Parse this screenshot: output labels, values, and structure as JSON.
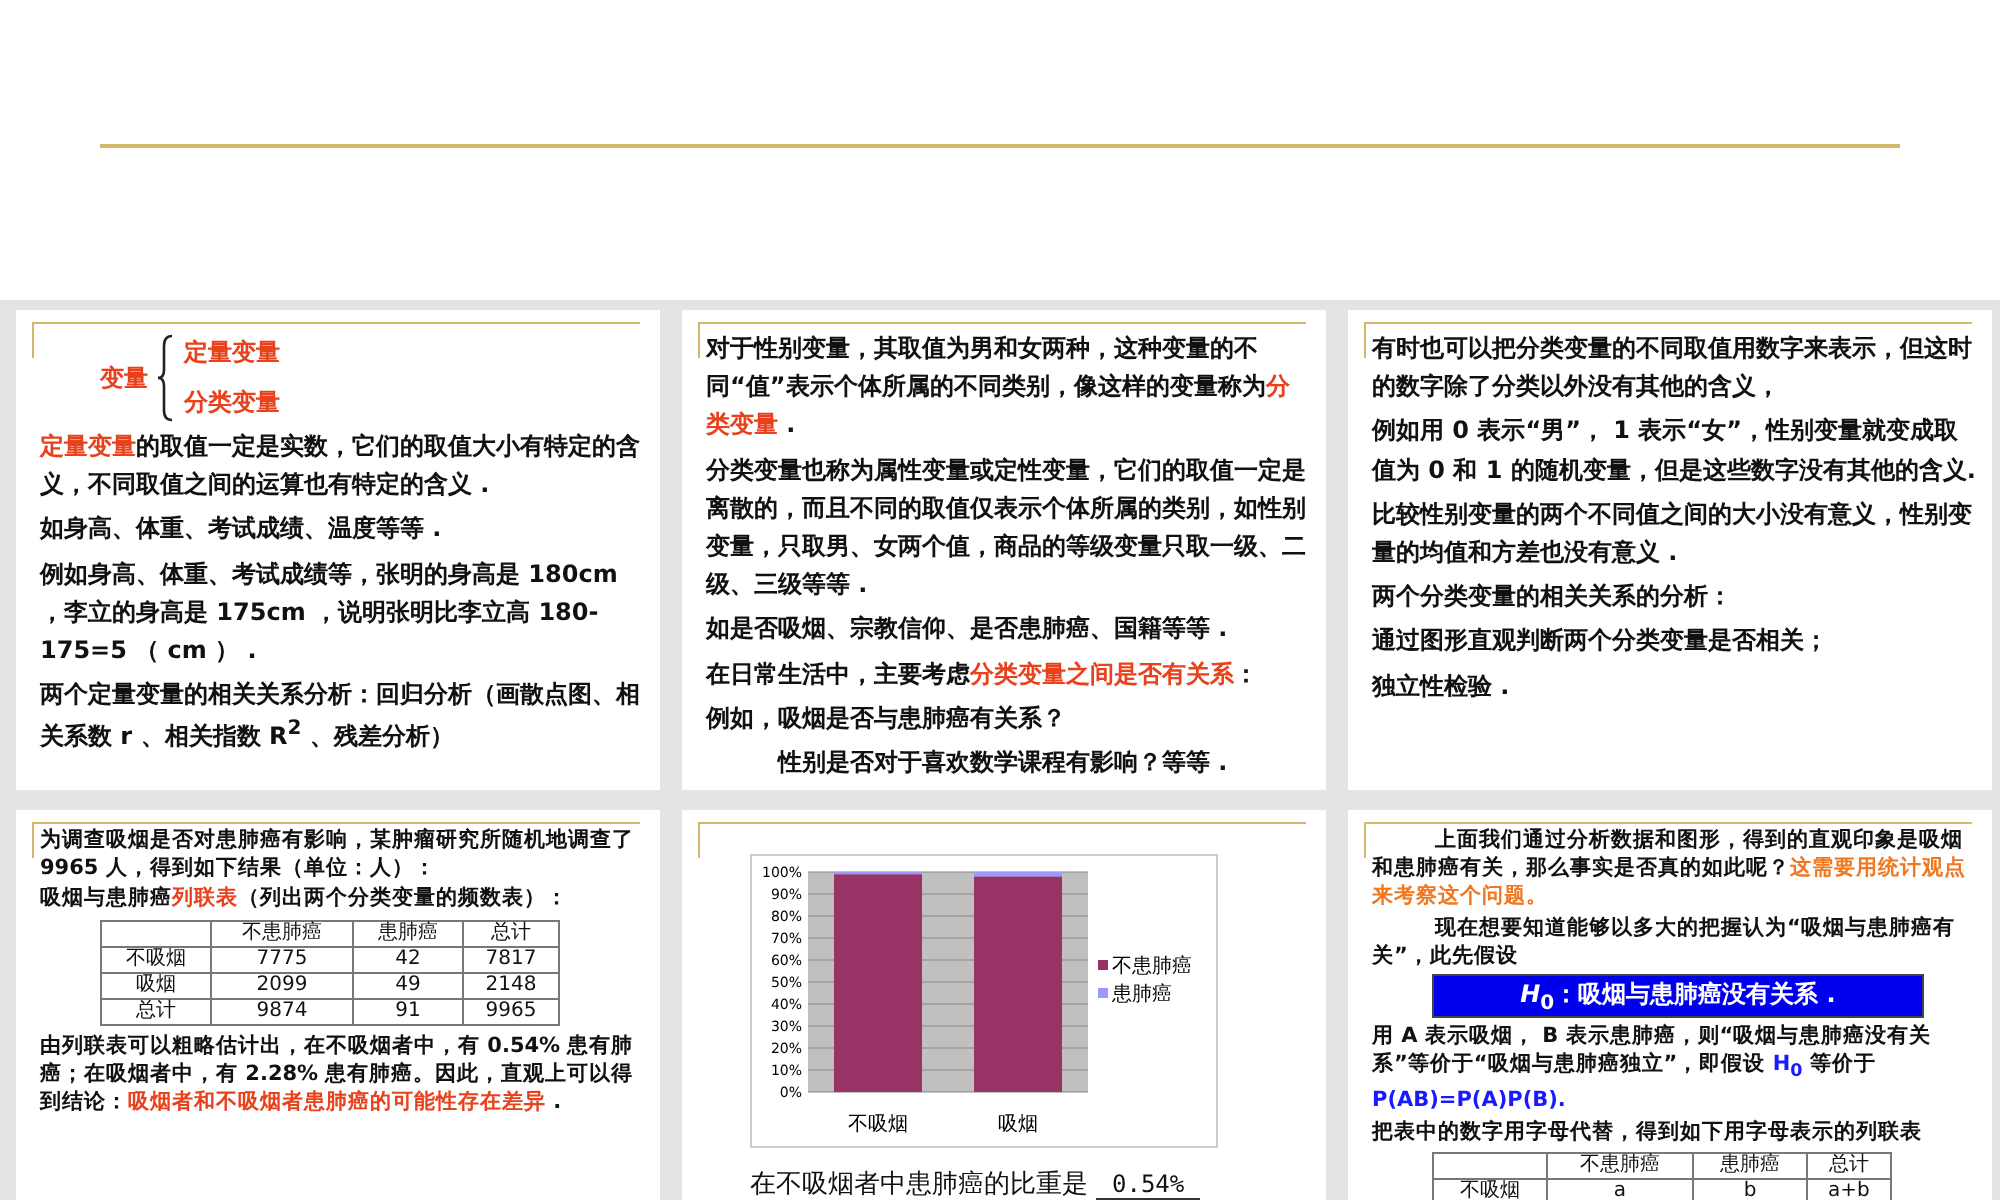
{
  "slides": [
    {
      "blocks": [
        {
          "kind": "brace",
          "label": "变量",
          "branches": [
            "定量变量",
            "分类变量"
          ]
        },
        {
          "kind": "paragraph",
          "segments": [
            {
              "text": "定量变量",
              "color": "#e8411c"
            },
            {
              "text": "的取值一定是实数，它们的取值大小有特定的含义，不同取值之间的运算也有特定的含义 ."
            }
          ]
        },
        {
          "kind": "paragraph",
          "segments": [
            {
              "text": " 如身高、体重、考试成绩、温度等等 ."
            }
          ]
        },
        {
          "kind": "paragraph",
          "segments": [
            {
              "text": "例如身高、体重、考试成绩等，张明的身高是 180cm ，李立的身高是 175cm ，说明张明比李立高 180-175=5 （ cm ） ."
            }
          ]
        },
        {
          "kind": "paragraph",
          "segments": [
            {
              "text": " 两个定量变量的相关关系分析：回归分析（画散点图、相关系数 r 、相关指数 R$^{2}$ 、残差分析）"
            }
          ]
        }
      ]
    },
    {
      "blocks": [
        {
          "kind": "paragraph",
          "segments": [
            {
              "text": "对于性别变量，其取值为男和女两种，这种变量的不同“值”表示个体所属的不同类别，像这样的变量称为"
            },
            {
              "text": "分类变量",
              "color": "#e8411c"
            },
            {
              "text": " ."
            }
          ]
        },
        {
          "kind": "paragraph",
          "segments": [
            {
              "text": " 分类变量也称为属性变量或定性变量，它们的取值一定是离散的，而且不同的取值仅表示个体所属的类别，如性别变量，只取男、女两个值，商品的等级变量只取一级、二级、三级等等 ."
            }
          ]
        },
        {
          "kind": "paragraph",
          "segments": [
            {
              "text": " 如是否吸烟、宗教信仰、是否患肺癌、国籍等等 ."
            }
          ]
        },
        {
          "kind": "paragraph",
          "segments": [
            {
              "text": " 在日常生活中，主要考虑"
            },
            {
              "text": "分类变量之间是否有关系",
              "color": "#e8411c"
            },
            {
              "text": "："
            }
          ]
        },
        {
          "kind": "paragraph",
          "segments": [
            {
              "text": " 例如，吸烟是否与患肺癌有关系？"
            }
          ]
        },
        {
          "kind": "paragraph",
          "indented": true,
          "segments": [
            {
              "text": "性别是否对于喜欢数学课程有影响？等等 ."
            }
          ]
        }
      ]
    },
    {
      "blocks": [
        {
          "kind": "paragraph",
          "segments": [
            {
              "text": "有时也可以把分类变量的不同取值用数字来表示，但这时的数字除了分类以外没有其他的含义，"
            }
          ]
        },
        {
          "kind": "paragraph",
          "segments": [
            {
              "text": "例如用 0 表示“男”， 1 表示“女”，性别变量就变成取值为 0 和 1 的随机变量，但是这些数字没有其他的含义."
            }
          ]
        },
        {
          "kind": "paragraph",
          "segments": [
            {
              "text": "比较性别变量的两个不同值之间的大小没有意义，性别变量的均值和方差也没有意义 ."
            }
          ]
        },
        {
          "kind": "paragraph",
          "segments": [
            {
              "text": "两个分类变量的相关关系的分析："
            }
          ]
        },
        {
          "kind": "paragraph",
          "segments": [
            {
              "text": "通过图形直观判断两个分类变量是否相关；"
            }
          ]
        },
        {
          "kind": "paragraph",
          "segments": [
            {
              "text": "独立性检验 ."
            }
          ]
        }
      ]
    },
    {
      "blocks": [
        {
          "kind": "paragraph",
          "segments": [
            {
              "text": "为调查吸烟是否对患肺癌有影响，某肿瘤研究所随机地调查了 9965 人，得到如下结果（单位：人）："
            }
          ]
        },
        {
          "kind": "paragraph",
          "segments": [
            {
              "text": "吸烟与患肺癌"
            },
            {
              "text": "列联表",
              "color": "#e8411c"
            },
            {
              "text": "（列出两个分类变量的频数表）："
            }
          ]
        },
        {
          "kind": "table",
          "columns": [
            "",
            "不患肺癌",
            "患肺癌",
            "总计"
          ],
          "rows": [
            [
              "不吸烟",
              "7775",
              "42",
              "7817"
            ],
            [
              "吸烟",
              "2099",
              "49",
              "2148"
            ],
            [
              "总计",
              "9874",
              "91",
              "9965"
            ]
          ]
        },
        {
          "kind": "paragraph",
          "segments": [
            {
              "text": "由列联表可以粗略估计出，在不吸烟者中，有 0.54% 患有肺癌；在吸烟者中，有 2.28% 患有肺癌。因此，直观上可以得到结论："
            },
            {
              "text": "吸烟者和不吸烟者患肺癌的可能性存在差异",
              "color": "#e8411c"
            },
            {
              "text": " ."
            }
          ]
        }
      ]
    },
    {
      "blocks": [
        {
          "kind": "chart",
          "chart_data": {
            "type": "bar",
            "stacked": true,
            "grid": true,
            "legend": true,
            "categories": [
              "不吸烟",
              "吸烟"
            ],
            "series": [
              {
                "name": "不患肺癌",
                "color": "#993366",
                "values": [
                  99,
                  98
                ]
              },
              {
                "name": "患肺癌",
                "color": "#9999ff",
                "values": [
                  1,
                  2
                ]
              }
            ],
            "ylim": [
              0,
              100
            ],
            "yticks": [
              {
                "value": 0,
                "label": "0%"
              },
              {
                "value": 10,
                "label": "10%"
              },
              {
                "value": 20,
                "label": "20%"
              },
              {
                "value": 30,
                "label": "30%"
              },
              {
                "value": 40,
                "label": "40%"
              },
              {
                "value": 50,
                "label": "50%"
              },
              {
                "value": 60,
                "label": "60%"
              },
              {
                "value": 70,
                "label": "70%"
              },
              {
                "value": 80,
                "label": "80%"
              },
              {
                "value": 90,
                "label": "90%"
              },
              {
                "value": 100,
                "label": "100%"
              }
            ]
          }
        },
        {
          "kind": "fill_in",
          "text": "在不吸烟者中患肺癌的比重是",
          "answer": "0.54%"
        }
      ]
    },
    {
      "blocks": [
        {
          "kind": "paragraph",
          "indented": true,
          "segments": [
            {
              "text": "上面我们通过分析数据和图形，得到的直观印象是吸烟和患肺癌有关，那么事实是否真的如此呢？"
            },
            {
              "text": "这需要用统计观点来考察这个问题。",
              "color": "#f07820"
            }
          ]
        },
        {
          "kind": "paragraph",
          "indented": true,
          "segments": [
            {
              "text": "现在想要知道能够以多大的把握认为“吸烟与患肺癌有关”，此先假设"
            }
          ]
        },
        {
          "kind": "banner",
          "text": "*H*$_{0}$：吸烟与患肺癌没有关系 ."
        },
        {
          "kind": "paragraph",
          "segments": [
            {
              "text": " 用 A 表示吸烟， B 表示患肺癌，则“吸烟与患肺癌没有关系”等价于“吸烟与患肺癌独立”，即假设 "
            },
            {
              "text": "H$_{0}$",
              "color": "#1a1aff"
            },
            {
              "text": " 等价于 "
            },
            {
              "text": "P(AB)=P(A)P(B).",
              "color": "#1a1aff"
            }
          ]
        },
        {
          "kind": "paragraph",
          "segments": [
            {
              "text": " 把表中的数字用字母代替，得到如下用字母表示的列联表"
            }
          ]
        },
        {
          "kind": "table",
          "columns": [
            "",
            "不患肺癌",
            "患肺癌",
            "总计"
          ],
          "rows": [
            [
              "不吸烟",
              "a",
              "b",
              "a+b"
            ]
          ]
        }
      ]
    }
  ]
}
